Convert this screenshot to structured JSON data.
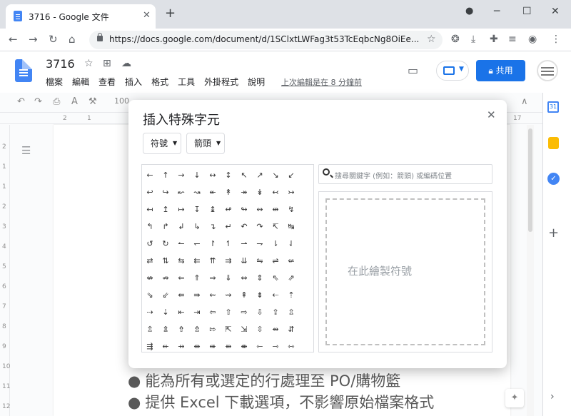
{
  "browser": {
    "tab_title": "3716 - Google 文件",
    "tab_close": "✕",
    "new_tab": "+",
    "url": "https://docs.google.com/document/d/1SClxtLWFag3t53TcEqbcNg8OiEe...",
    "window_controls": [
      "─",
      "☐",
      "✕"
    ]
  },
  "doc": {
    "title": "3716",
    "menu": [
      "檔案",
      "編輯",
      "查看",
      "插入",
      "格式",
      "工具",
      "外掛程式",
      "說明"
    ],
    "last_edit": "上次編輯是在 8 分鐘前",
    "share_label": "共用",
    "zoom": "100",
    "ruler_marks": [
      "2",
      "1",
      "17"
    ],
    "left_ruler_marks": [
      "2",
      "1",
      "1",
      "2",
      "3",
      "4",
      "5",
      "6",
      "7",
      "8",
      "9",
      "10",
      "11",
      "12"
    ],
    "lines": [
      "能為所有或選定的行處理至 PO/購物籃",
      "提供 Excel 下載選項，不影響原始檔案格式"
    ]
  },
  "dialog": {
    "title": "插入特殊字元",
    "close": "✕",
    "category": "符號",
    "subcategory": "箭頭",
    "search_placeholder": "搜尋關鍵字 (例如：箭頭) 或編碼位置",
    "draw_hint": "在此繪製符號",
    "symbols": [
      [
        "←",
        "↑",
        "→",
        "↓",
        "↔",
        "↕",
        "↖",
        "↗",
        "↘",
        "↙"
      ],
      [
        "↩",
        "↪",
        "↜",
        "↝",
        "↞",
        "↟",
        "↠",
        "↡",
        "↢",
        "↣"
      ],
      [
        "↤",
        "↥",
        "↦",
        "↧",
        "↨",
        "↫",
        "↬",
        "↭",
        "↮",
        "↯"
      ],
      [
        "↰",
        "↱",
        "↲",
        "↳",
        "↴",
        "↵",
        "↶",
        "↷",
        "↸",
        "↹"
      ],
      [
        "↺",
        "↻",
        "↼",
        "↽",
        "↾",
        "↿",
        "⇀",
        "⇁",
        "⇂",
        "⇃"
      ],
      [
        "⇄",
        "⇅",
        "⇆",
        "⇇",
        "⇈",
        "⇉",
        "⇊",
        "⇋",
        "⇌",
        "⇍"
      ],
      [
        "⇎",
        "⇏",
        "⇐",
        "⇑",
        "⇒",
        "⇓",
        "⇔",
        "⇕",
        "⇖",
        "⇗"
      ],
      [
        "⇘",
        "⇙",
        "⇚",
        "⇛",
        "⇜",
        "⇝",
        "⇞",
        "⇟",
        "⇠",
        "⇡"
      ],
      [
        "⇢",
        "⇣",
        "⇤",
        "⇥",
        "⇦",
        "⇧",
        "⇨",
        "⇩",
        "⇪",
        "⇫"
      ],
      [
        "⇬",
        "⇭",
        "⇮",
        "⇯",
        "⇰",
        "⇱",
        "⇲",
        "⇳",
        "⇴",
        "⇵"
      ],
      [
        "⇶",
        "⇷",
        "⇸",
        "⇹",
        "⇺",
        "⇻",
        "⇼",
        "⇽",
        "⇾",
        "⇿"
      ]
    ]
  }
}
